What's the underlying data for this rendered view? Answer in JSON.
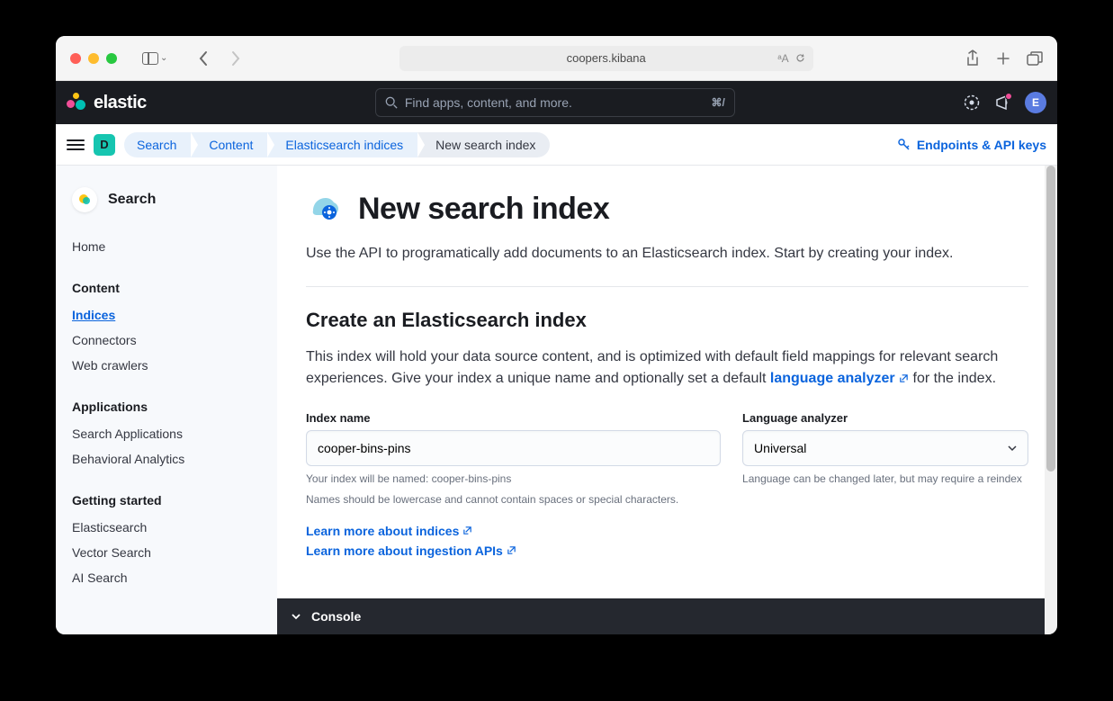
{
  "browser": {
    "url": "coopers.kibana"
  },
  "header": {
    "brand": "elastic",
    "search_placeholder": "Find apps, content, and more.",
    "search_kbd": "⌘/",
    "avatar_initial": "E"
  },
  "breadcrumb": {
    "space_initial": "D",
    "items": [
      "Search",
      "Content",
      "Elasticsearch indices",
      "New search index"
    ],
    "right_link": "Endpoints & API keys"
  },
  "sidebar": {
    "title": "Search",
    "home": "Home",
    "sections": [
      {
        "label": "Content",
        "items": [
          "Indices",
          "Connectors",
          "Web crawlers"
        ],
        "active": "Indices"
      },
      {
        "label": "Applications",
        "items": [
          "Search Applications",
          "Behavioral Analytics"
        ]
      },
      {
        "label": "Getting started",
        "items": [
          "Elasticsearch",
          "Vector Search",
          "AI Search"
        ]
      }
    ]
  },
  "page": {
    "title": "New search index",
    "description": "Use the API to programatically add documents to an Elasticsearch index. Start by creating your index.",
    "section_title": "Create an Elasticsearch index",
    "section_desc_1": "This index will hold your data source content, and is optimized with default field mappings for relevant search experiences. Give your index a unique name and optionally set a default ",
    "section_link": "language analyzer",
    "section_desc_2": " for the index.",
    "index_label": "Index name",
    "index_value": "cooper-bins-pins",
    "index_help_1": "Your index will be named: cooper-bins-pins",
    "index_help_2": "Names should be lowercase and cannot contain spaces or special characters.",
    "lang_label": "Language analyzer",
    "lang_value": "Universal",
    "lang_help": "Language can be changed later, but may require a reindex",
    "learn_1": "Learn more about indices",
    "learn_2": "Learn more about ingestion APIs"
  },
  "console": {
    "label": "Console"
  }
}
